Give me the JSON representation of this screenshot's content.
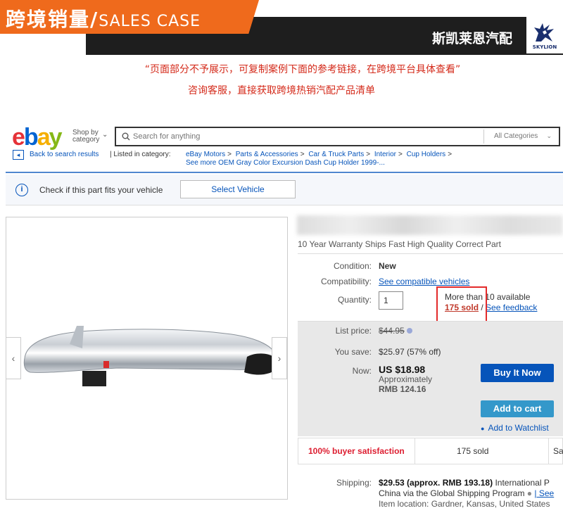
{
  "banner": {
    "title_cn": "跨境销量/",
    "title_en": "SALES CASE",
    "brand": "斯凯莱恩汽配",
    "logo_text": "SKYLION"
  },
  "notice": {
    "line1": "“页面部分不予展示，可复制案例下面的参考链接，在跨境平台具体查看”",
    "line2": "咨询客服，直接获取跨境热销汽配产品清单"
  },
  "ebay": {
    "logo": {
      "e": "e",
      "b": "b",
      "a": "a",
      "y": "y"
    },
    "shop_by": "Shop by category",
    "search_placeholder": "Search for anything",
    "category_select": "All Categories",
    "back_link": "Back to search results",
    "listed_label": "| Listed in category:",
    "breadcrumbs": [
      "eBay Motors",
      "Parts & Accessories",
      "Car & Truck Parts",
      "Interior",
      "Cup Holders"
    ],
    "breadcrumb_more": "See more OEM Gray Color Excursion Dash Cup Holder 1999-..."
  },
  "fitment": {
    "text": "Check if this part fits your vehicle",
    "button": "Select Vehicle"
  },
  "item": {
    "subtitle": "10 Year Warranty Ships Fast High Quality Correct Part",
    "condition_label": "Condition:",
    "condition_value": "New",
    "compat_label": "Compatibility:",
    "compat_link": "See compatible vehicles",
    "qty_label": "Quantity:",
    "qty_value": "1",
    "available": "More than 10 available",
    "sold": "175 sold",
    "sold_sep": " / ",
    "feedback": "See feedback"
  },
  "price": {
    "list_label": "List price:",
    "list_value": "$44.95",
    "save_label": "You save:",
    "save_value": "$25.97 (57% off)",
    "now_label": "Now:",
    "now_value": "US $18.98",
    "approx": "Approximately",
    "rmb": "RMB 124.16",
    "buy_now": "Buy It Now",
    "add_cart": "Add to cart",
    "watchlist": "Add to Watchlist"
  },
  "stats": {
    "satisfaction": "100% buyer satisfaction",
    "sold": "175 sold",
    "cut": "Sa"
  },
  "shipping": {
    "label": "Shipping:",
    "price": "$29.53",
    "approx": "(approx. RMB 193.18)",
    "tail": "International P",
    "line2": "China  via the Global Shipping Program",
    "line2_tail": "| See",
    "line3": "Item location: Gardner, Kansas, United States"
  },
  "colors": {
    "ebay_blue": "#0654ba",
    "banner_orange": "#ef6a1c",
    "highlight_red": "#e32a2a"
  }
}
